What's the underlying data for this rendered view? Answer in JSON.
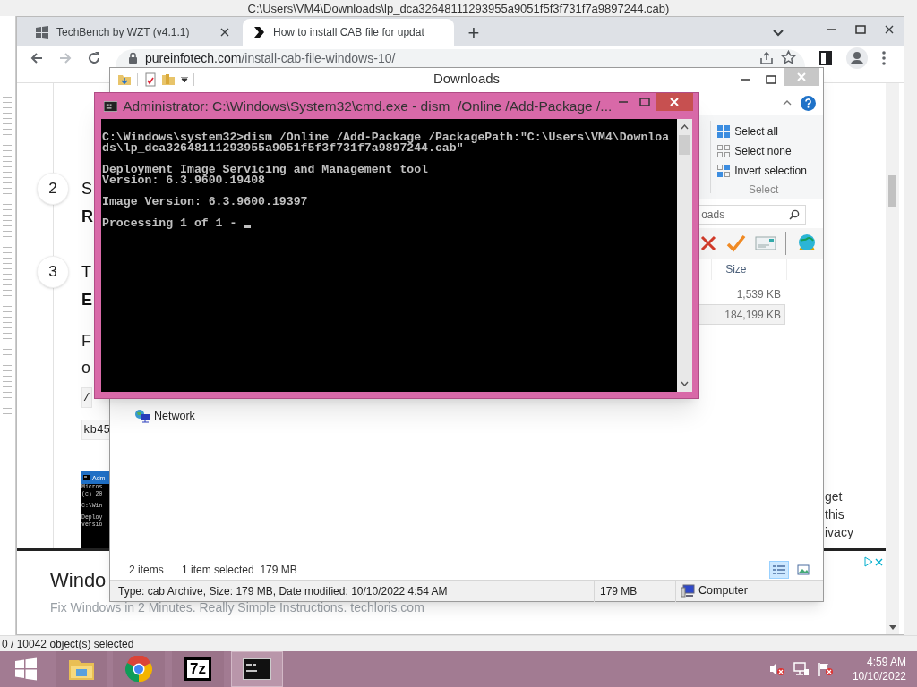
{
  "desktop_window": {
    "title": "C:\\Users\\VM4\\Downloads\\lp_dca32648111293955a9051f5f3f731f7a9897244.cab)",
    "status": "0 / 10042 object(s) selected"
  },
  "browser": {
    "tabs": [
      {
        "title": "TechBench by WZT (v4.1.1)",
        "selected": false
      },
      {
        "title": "How to install CAB file for updat",
        "selected": true
      }
    ],
    "new_tab": "+",
    "url": {
      "domain": "pureinfotech.com",
      "path": "/install-cab-file-windows-10/"
    },
    "steps": [
      {
        "number": "2",
        "lines": [
          "S",
          "R"
        ]
      },
      {
        "number": "3",
        "lines": [
          "T",
          "E"
        ]
      }
    ],
    "paragraph_lines": [
      "F",
      "o"
    ],
    "code_lines": [
      "/",
      "kb45"
    ],
    "screenshot": {
      "title": "Adm",
      "lines": [
        "Micros",
        "(c) 20",
        "C:\\Win",
        "Deploy",
        "Versio"
      ]
    },
    "notice_lines": [
      "get",
      "this",
      "ivacy"
    ],
    "ad": {
      "title": "Windo",
      "text": "Fix Windows in 2 Minutes. Really Simple Instructions. techloris.com"
    }
  },
  "explorer": {
    "title": "Downloads",
    "select_group": {
      "items": [
        "Select all",
        "Select none",
        "Invert selection"
      ],
      "label": "Select"
    },
    "search": "oads",
    "columns": [
      "Size"
    ],
    "rows": [
      {
        "size": "1,539 KB",
        "selected": false
      },
      {
        "size": "184,199 KB",
        "selected": true
      }
    ],
    "nav": [
      "Network"
    ],
    "status": {
      "count": "2 items",
      "selection": "1 item selected  179 MB"
    },
    "views": [
      {
        "kind": "details",
        "selected": true
      },
      {
        "kind": "preview",
        "selected": false
      }
    ],
    "details": {
      "info": "Type: cab Archive, Size: 179 MB, Date modified: 10/10/2022 4:54 AM",
      "size": "179 MB",
      "location": "Computer"
    }
  },
  "console": {
    "title": "Administrator: C:\\Windows\\System32\\cmd.exe - dism  /Online /Add-Package /...",
    "blocks": [
      [
        "C:\\Windows\\system32>dism /Online /Add-Package /PackagePath:\"C:\\Users\\VM4\\Downloa",
        "ds\\lp_dca32648111293955a9051f5f3f731f7a9897244.cab\""
      ],
      [
        "Deployment Image Servicing and Management tool",
        "Version: 6.3.9600.19408"
      ],
      [
        "Image Version: 6.3.9600.19397"
      ],
      [
        "Processing 1 of 1 -"
      ]
    ]
  },
  "taskbar": {
    "apps": [
      {
        "kind": "explorer",
        "selected": false
      },
      {
        "kind": "chrome",
        "selected": false
      },
      {
        "kind": "archiver",
        "label": "7z",
        "selected": false
      },
      {
        "kind": "console",
        "selected": true
      }
    ],
    "time": "4:59 AM",
    "date": "10/10/2022"
  }
}
